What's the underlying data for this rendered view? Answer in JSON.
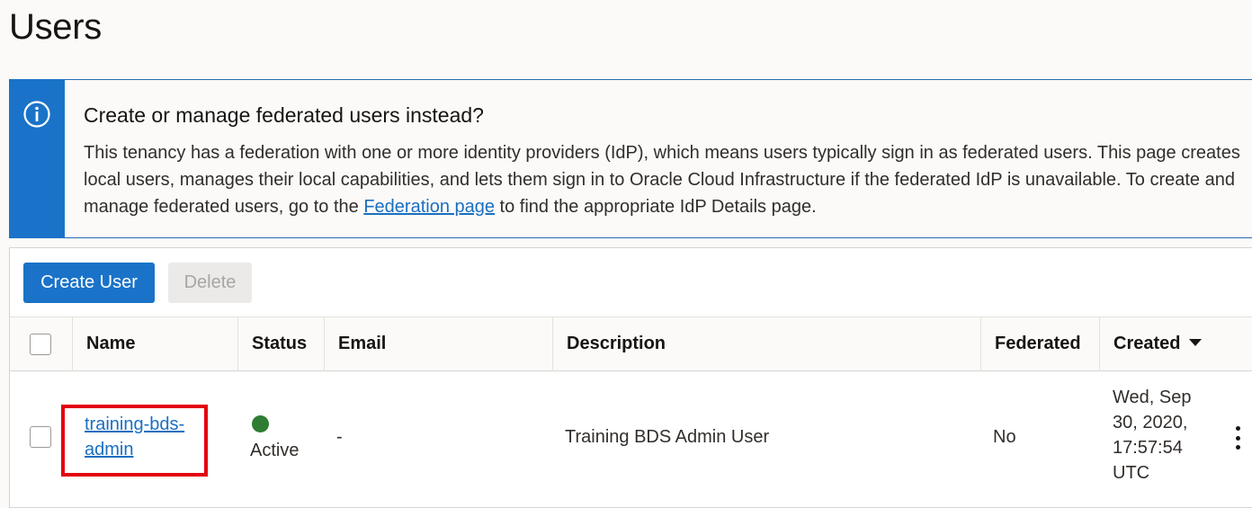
{
  "page": {
    "title": "Users"
  },
  "banner": {
    "heading": "Create or manage federated users instead?",
    "text_before_link": "This tenancy has a federation with one or more identity providers (IdP), which means users typically sign in as federated users. This page creates local users, manages their local capabilities, and lets them sign in to Oracle Cloud Infrastructure if the federated IdP is unavailable. To create and manage federated users, go to the ",
    "link_text": "Federation page",
    "text_after_link": " to find the appropriate IdP Details page.",
    "icon": "info-icon",
    "accent_color": "#1a73c8"
  },
  "toolbar": {
    "create_label": "Create User",
    "delete_label": "Delete"
  },
  "table": {
    "columns": [
      "Name",
      "Status",
      "Email",
      "Description",
      "Federated",
      "Created"
    ],
    "sorted_column": "Created",
    "rows": [
      {
        "name_line1": "training-bds-",
        "name_line2": "admin",
        "status": "Active",
        "status_color": "#2e7d32",
        "email": "-",
        "description": "Training BDS Admin User",
        "federated": "No",
        "created_line1": "Wed, Sep",
        "created_line2": "30, 2020,",
        "created_line3": "17:57:54",
        "created_line4": "UTC"
      }
    ]
  }
}
